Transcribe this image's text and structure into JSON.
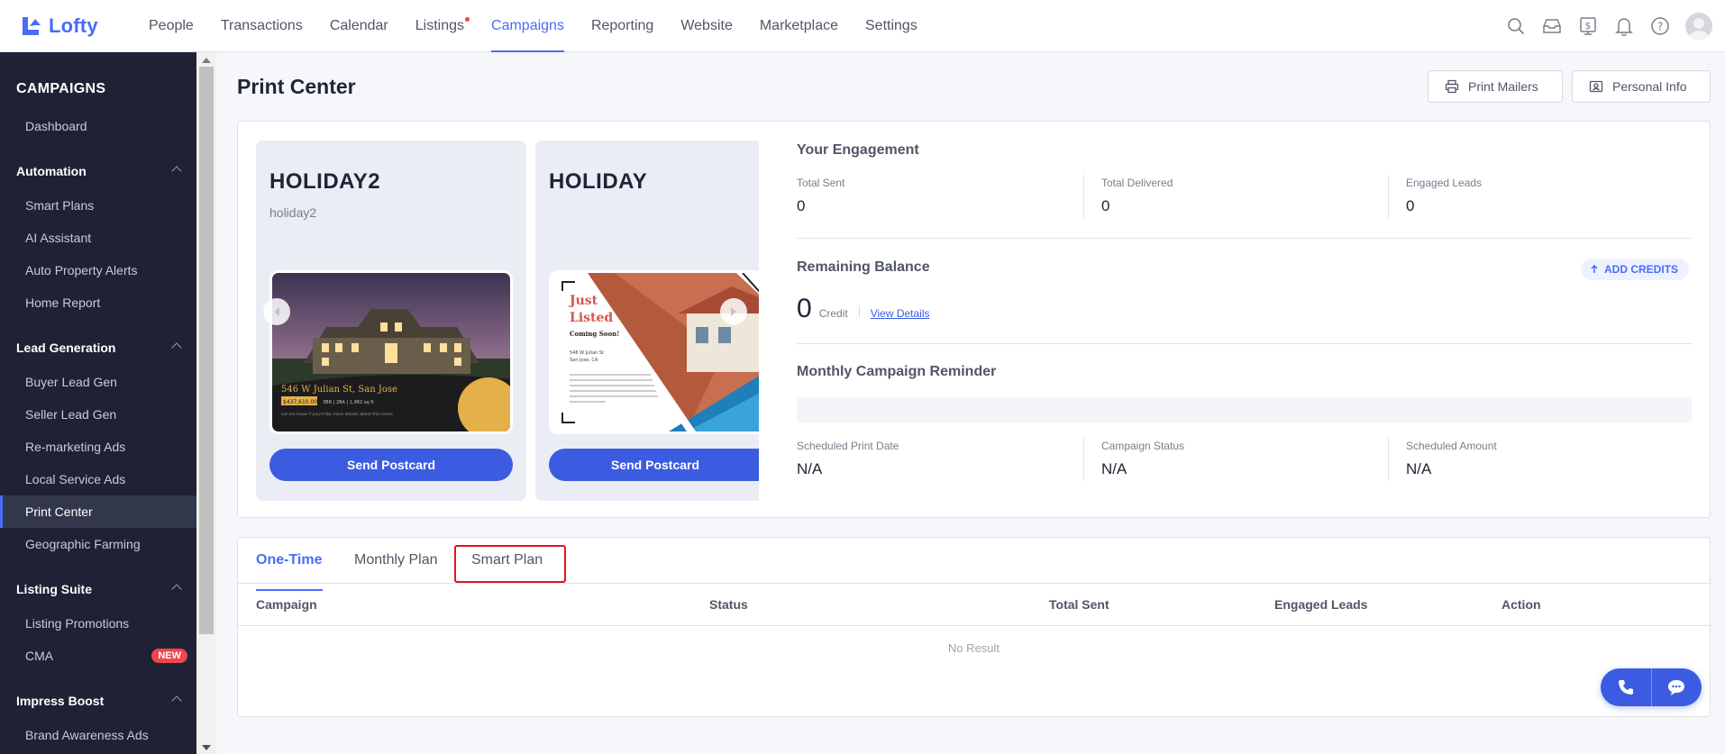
{
  "app": {
    "name": "Lofty",
    "brand_color": "#4a6cf7"
  },
  "topnav": {
    "items": [
      {
        "label": "People"
      },
      {
        "label": "Transactions"
      },
      {
        "label": "Calendar"
      },
      {
        "label": "Listings"
      },
      {
        "label": "Campaigns"
      },
      {
        "label": "Reporting"
      },
      {
        "label": "Website"
      },
      {
        "label": "Marketplace"
      },
      {
        "label": "Settings"
      }
    ],
    "active": "Campaigns",
    "icons": [
      "search-icon",
      "inbox-icon",
      "billing-icon",
      "bell-icon",
      "help-icon",
      "avatar"
    ]
  },
  "sidebar": {
    "title": "CAMPAIGNS",
    "dashboard": "Dashboard",
    "groups": [
      {
        "label": "Automation",
        "items": [
          "Smart Plans",
          "AI Assistant",
          "Auto Property Alerts",
          "Home Report"
        ]
      },
      {
        "label": "Lead Generation",
        "items": [
          "Buyer Lead Gen",
          "Seller Lead Gen",
          "Re-marketing Ads",
          "Local Service Ads",
          "Print Center",
          "Geographic Farming"
        ]
      },
      {
        "label": "Listing Suite",
        "items": [
          "Listing Promotions",
          "CMA"
        ]
      },
      {
        "label": "Impress Boost",
        "items": [
          "Brand Awareness Ads"
        ]
      }
    ],
    "active_item": "Print Center",
    "new_badge": "NEW"
  },
  "page": {
    "title": "Print Center",
    "buttons": {
      "print_mailers": "Print Mailers",
      "personal_info": "Personal Info"
    }
  },
  "cards": [
    {
      "title": "HOLIDAY2",
      "subtitle": "holiday2",
      "send_label": "Send Postcard",
      "postcard": {
        "address": "546 W Julian St, San Jose",
        "price": "$437,610.00",
        "details": "3BR | 2BA | 1,982 sq ft",
        "note": "Let me know if you'd like more details about this home"
      }
    },
    {
      "title": "HOLIDAY",
      "subtitle": "",
      "send_label": "Send Postcard",
      "postcard": {
        "headline1": "Just",
        "headline2": "Listed",
        "sub": "Coming Soon!",
        "addr1": "546 W Julian St",
        "addr2": "San Jose, CA"
      }
    }
  ],
  "engagement": {
    "title": "Your Engagement",
    "stats": [
      {
        "label": "Total Sent",
        "value": "0"
      },
      {
        "label": "Total Delivered",
        "value": "0"
      },
      {
        "label": "Engaged Leads",
        "value": "0"
      }
    ]
  },
  "balance": {
    "title": "Remaining Balance",
    "add_credits": "ADD CREDITS",
    "amount": "0",
    "unit": "Credit",
    "view_details": "View Details"
  },
  "reminder": {
    "title": "Monthly Campaign Reminder",
    "stats": [
      {
        "label": "Scheduled Print Date",
        "value": "N/A"
      },
      {
        "label": "Campaign Status",
        "value": "N/A"
      },
      {
        "label": "Scheduled Amount",
        "value": "N/A"
      }
    ]
  },
  "tabs": {
    "items": [
      "One-Time",
      "Monthly Plan",
      "Smart Plan"
    ],
    "active": "One-Time",
    "highlighted": "Smart Plan"
  },
  "table": {
    "columns": [
      "Campaign",
      "Status",
      "Total Sent",
      "Engaged Leads",
      "Action"
    ],
    "empty_text": "No Result"
  }
}
